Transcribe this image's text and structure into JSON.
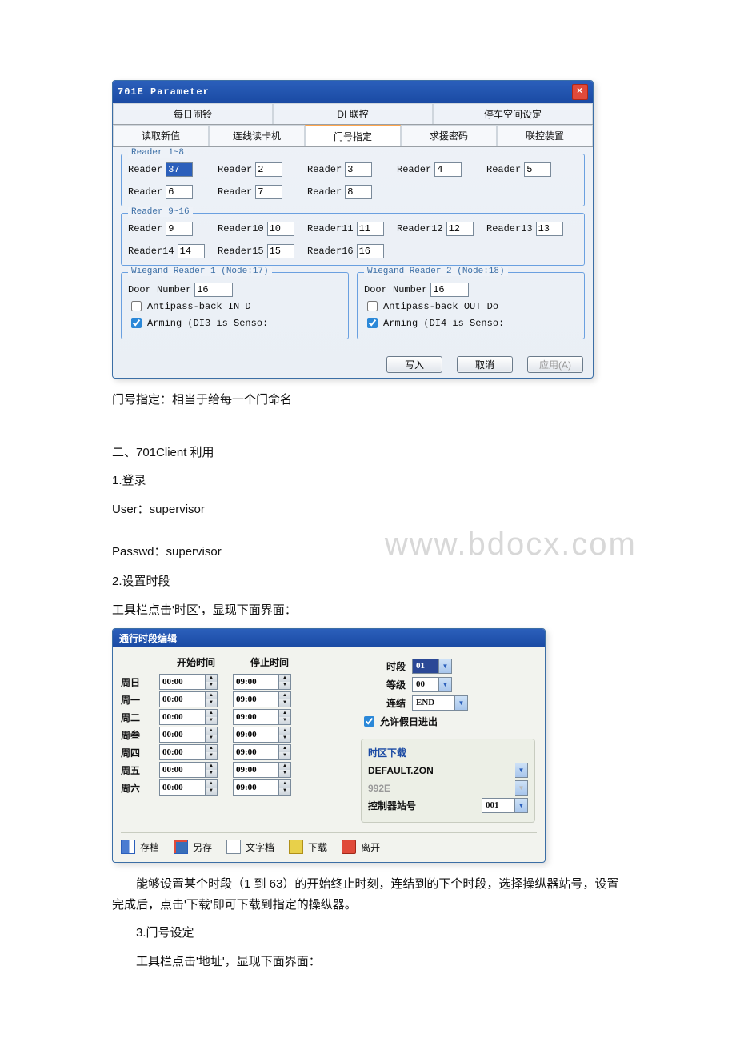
{
  "dialog1": {
    "title": "701E Parameter",
    "tabs_top": [
      "每日闹铃",
      "DI 联控",
      "停车空间设定"
    ],
    "tabs_bottom": [
      "读取新值",
      "连线读卡机",
      "门号指定",
      "求援密码",
      "联控装置"
    ],
    "active_tab": "门号指定",
    "group1": {
      "legend": "Reader 1~8",
      "readers": [
        {
          "label": "Reader",
          "value": "37",
          "hl": true
        },
        {
          "label": "Reader",
          "value": "2"
        },
        {
          "label": "Reader",
          "value": "3"
        },
        {
          "label": "Reader",
          "value": "4"
        },
        {
          "label": "Reader",
          "value": "5"
        },
        {
          "label": "Reader",
          "value": "6"
        },
        {
          "label": "Reader",
          "value": "7"
        },
        {
          "label": "Reader",
          "value": "8"
        }
      ]
    },
    "group2": {
      "legend": "Reader 9~16",
      "readers": [
        {
          "label": "Reader",
          "value": "9"
        },
        {
          "label": "Reader10",
          "value": "10"
        },
        {
          "label": "Reader11",
          "value": "11"
        },
        {
          "label": "Reader12",
          "value": "12"
        },
        {
          "label": "Reader13",
          "value": "13"
        },
        {
          "label": "Reader14",
          "value": "14"
        },
        {
          "label": "Reader15",
          "value": "15"
        },
        {
          "label": "Reader16",
          "value": "16"
        }
      ]
    },
    "wiegand1": {
      "legend": "Wiegand Reader 1 (Node:17)",
      "door_label": "Door Number",
      "door_value": "16",
      "antipass_label": "Antipass-back  IN  D",
      "antipass_checked": false,
      "arming_label": "Arming (DI3 is Senso:",
      "arming_checked": true
    },
    "wiegand2": {
      "legend": "Wiegand Reader 2 (Node:18)",
      "door_label": "Door Number",
      "door_value": "16",
      "antipass_label": "Antipass-back  OUT  Do",
      "antipass_checked": false,
      "arming_label": "Arming (DI4 is Senso:",
      "arming_checked": true
    },
    "buttons": {
      "write": "写入",
      "cancel": "取消",
      "apply": "应用(A)"
    }
  },
  "doc": {
    "after_dialog1": "门号指定：相当于给每一个门命名",
    "section2": "二、701Client 利用",
    "login_h": "1.登录",
    "user_line": "User：supervisor",
    "passwd_line": "Passwd：supervisor",
    "watermark": "www.bdocx.com",
    "period_h": "2.设置时段",
    "period_hint": "工具栏点击'时区'，显现下面界面：",
    "after_dialog2": "能够设置某个时段（1 到 63）的开始终止时刻，连结到的下个时段，选择操纵器站号，设置完成后，点击'下载'即可下载到指定的操纵器。",
    "door_h": "3.门号设定",
    "door_hint": "工具栏点击'地址'，显现下面界面："
  },
  "dialog2": {
    "title": "通行时段编辑",
    "hdr_start": "开始时间",
    "hdr_stop": "停止时间",
    "days": [
      {
        "name": "周日",
        "start": "00:00",
        "stop": "09:00"
      },
      {
        "name": "周一",
        "start": "00:00",
        "stop": "09:00"
      },
      {
        "name": "周二",
        "start": "00:00",
        "stop": "09:00"
      },
      {
        "name": "周叁",
        "start": "00:00",
        "stop": "09:00"
      },
      {
        "name": "周四",
        "start": "00:00",
        "stop": "09:00"
      },
      {
        "name": "周五",
        "start": "00:00",
        "stop": "09:00"
      },
      {
        "name": "周六",
        "start": "00:00",
        "stop": "09:00"
      }
    ],
    "lbl_period": "时段",
    "val_period": "01",
    "lbl_level": "等级",
    "val_level": "00",
    "lbl_link": "连结",
    "val_link": "END",
    "holiday_label": "允许假日进出",
    "holiday_checked": true,
    "tz_panel": {
      "title": "时区下载",
      "line1": "DEFAULT.ZON",
      "line2": "992E",
      "station_label": "控制器站号",
      "station_val": "001"
    },
    "buttons": {
      "save": "存档",
      "saveas": "另存",
      "text": "文字档",
      "download": "下载",
      "exit": "离开"
    }
  }
}
